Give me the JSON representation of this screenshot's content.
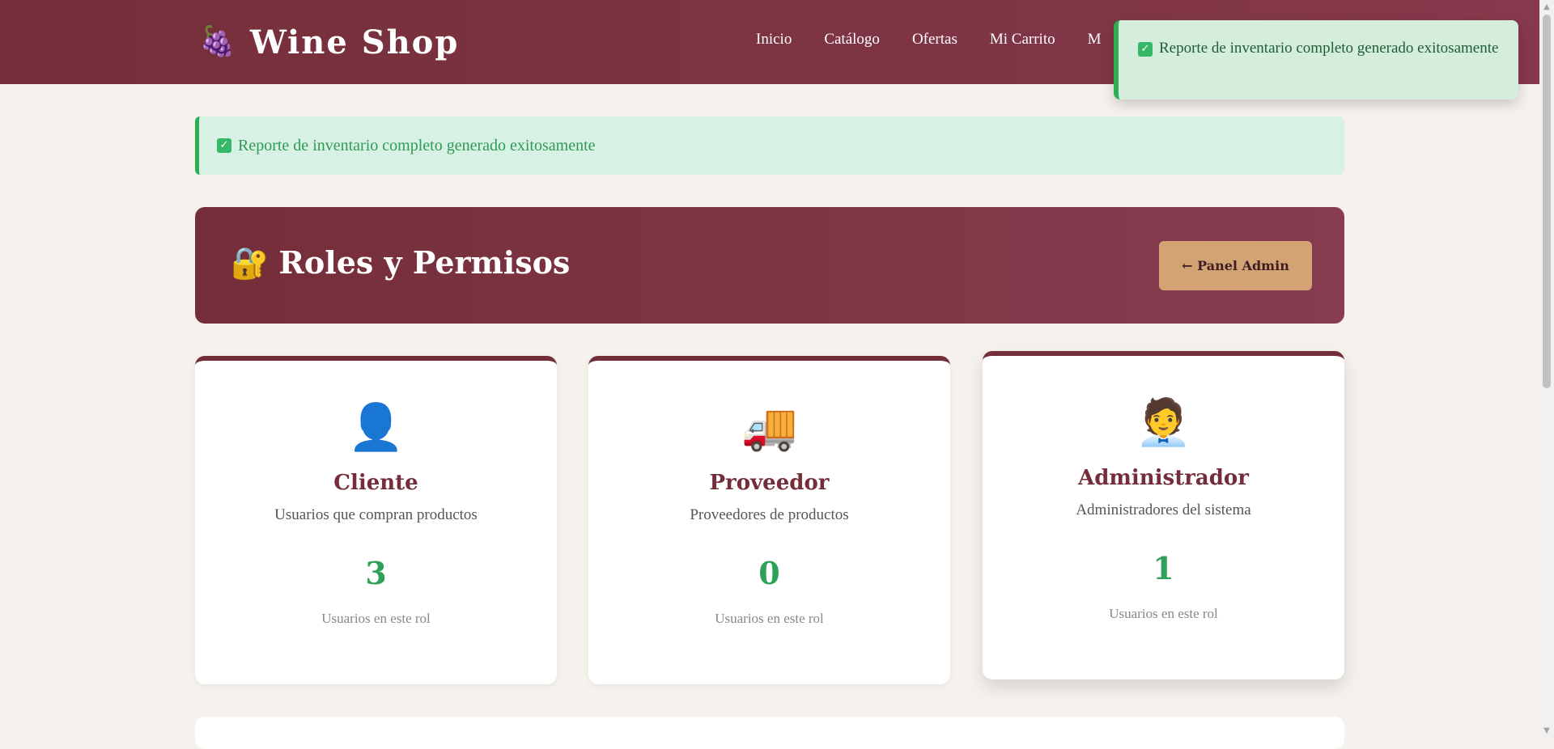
{
  "header": {
    "logo_icon": "🍇",
    "brand": "Wine Shop",
    "nav": [
      "Inicio",
      "Catálogo",
      "Ofertas",
      "Mi Carrito",
      "M"
    ]
  },
  "toast": {
    "icon": "check-icon",
    "message": "Reporte de inventario completo generado exitosamente"
  },
  "alert": {
    "icon": "check-icon",
    "message": "Reporte de inventario completo generado exitosamente"
  },
  "page_header": {
    "icon": "🔐",
    "title": "Roles y Permisos",
    "back_button": "← Panel Admin"
  },
  "roles": [
    {
      "icon": "👤",
      "name": "Cliente",
      "description": "Usuarios que compran productos",
      "count": "3",
      "count_label": "Usuarios en este rol"
    },
    {
      "icon": "🚚",
      "name": "Proveedor",
      "description": "Proveedores de productos",
      "count": "0",
      "count_label": "Usuarios en este rol"
    },
    {
      "icon": "🧑‍💼",
      "name": "Administrador",
      "description": "Administradores del sistema",
      "count": "1",
      "count_label": "Usuarios en este rol"
    }
  ],
  "colors": {
    "brand": "#742e39",
    "accent": "#d4a373",
    "success": "#2eae52",
    "background": "#f5f1ec"
  }
}
